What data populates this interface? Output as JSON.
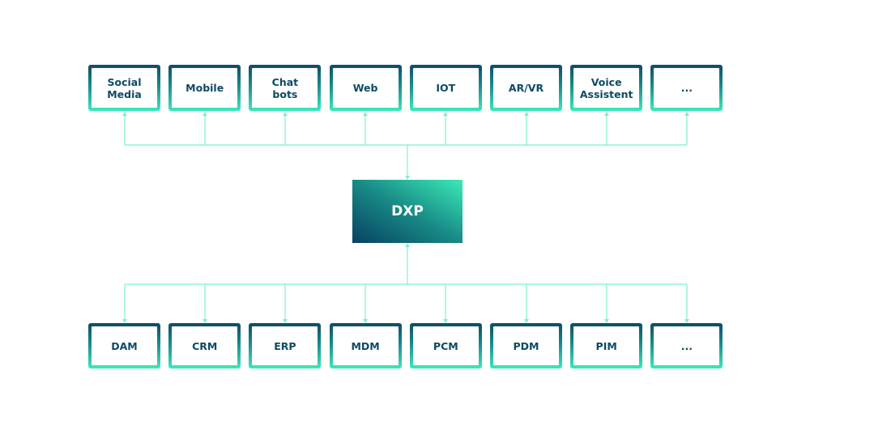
{
  "diagram": {
    "center": {
      "label": "DXP"
    },
    "channels": [
      {
        "label": "Social\nMedia"
      },
      {
        "label": "Mobile"
      },
      {
        "label": "Chat\nbots"
      },
      {
        "label": "Web"
      },
      {
        "label": "IOT"
      },
      {
        "label": "AR/VR"
      },
      {
        "label": "Voice\nAssistent"
      },
      {
        "label": "..."
      }
    ],
    "systems": [
      {
        "label": "DAM"
      },
      {
        "label": "CRM"
      },
      {
        "label": "ERP"
      },
      {
        "label": "MDM"
      },
      {
        "label": "PCM"
      },
      {
        "label": "PDM"
      },
      {
        "label": "PIM"
      },
      {
        "label": "..."
      }
    ],
    "flow": {
      "channels_direction": "from DXP to channels",
      "systems_direction": "from DXP to systems",
      "into_dxp": "both buses feed arrows into DXP"
    },
    "colors": {
      "dark": "#0e4c66",
      "accent": "#3deab9",
      "connector": "#7ef0cf",
      "text": "#0d4a63"
    }
  }
}
